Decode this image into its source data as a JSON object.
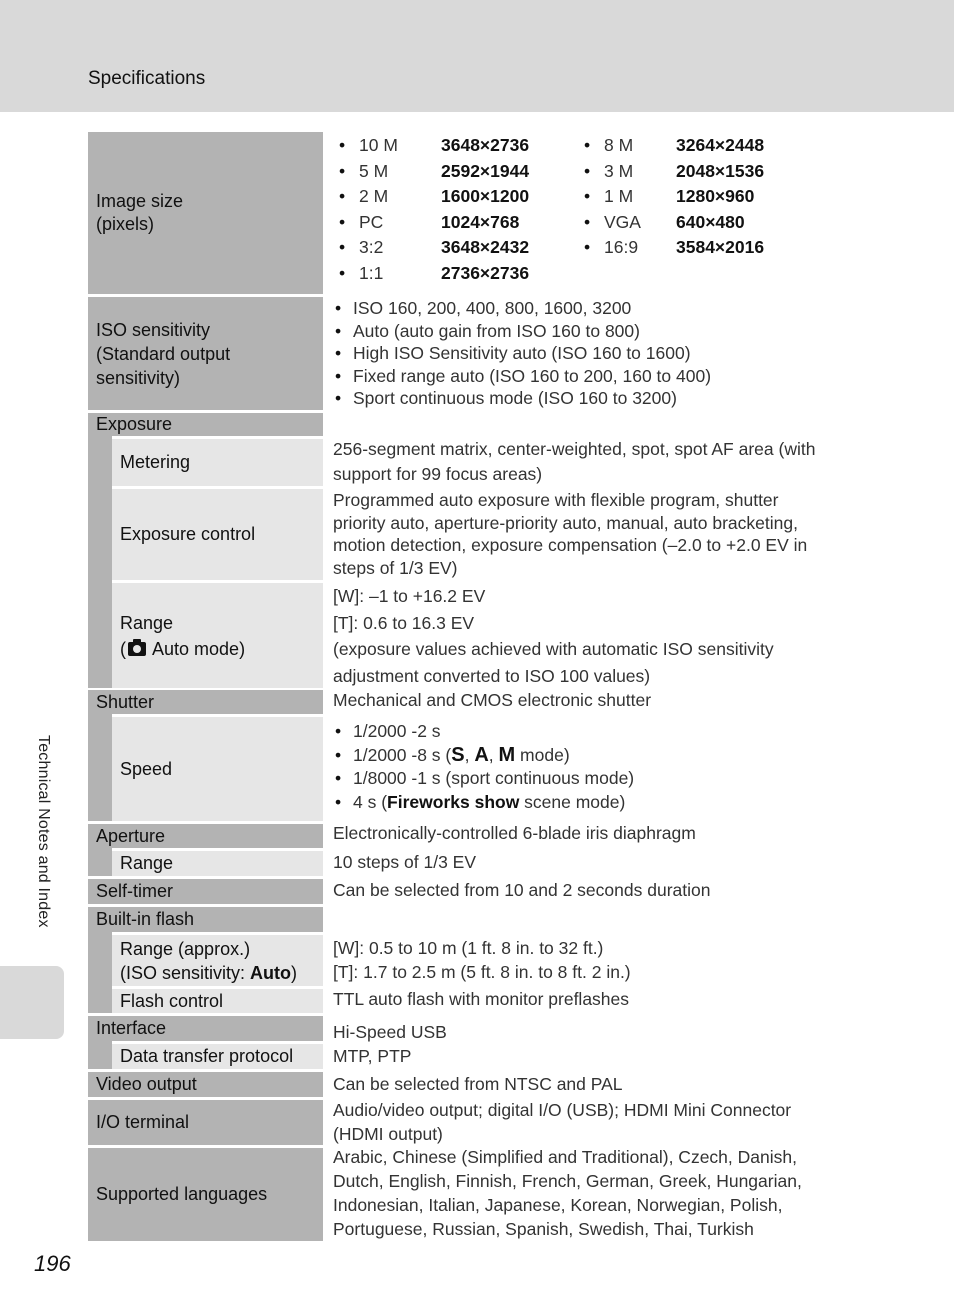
{
  "header": {
    "title": "Specifications"
  },
  "side_tab": {
    "label": "Technical Notes and Index"
  },
  "page_number": "196",
  "image_size": {
    "label_line1": "Image size",
    "label_line2": "(pixels)",
    "left": [
      {
        "name": "10 M",
        "res": "3648×2736"
      },
      {
        "name": "5 M",
        "res": "2592×1944"
      },
      {
        "name": "2 M",
        "res": "1600×1200"
      },
      {
        "name": "PC",
        "res": "1024×768"
      },
      {
        "name": "3:2",
        "res": "3648×2432"
      },
      {
        "name": "1:1",
        "res": "2736×2736"
      }
    ],
    "right": [
      {
        "name": "8 M",
        "res": "3264×2448"
      },
      {
        "name": "3 M",
        "res": "2048×1536"
      },
      {
        "name": "1 M",
        "res": "1280×960"
      },
      {
        "name": "VGA",
        "res": "640×480"
      },
      {
        "name": "16:9",
        "res": "3584×2016"
      }
    ]
  },
  "iso": {
    "label_lines": [
      "ISO sensitivity",
      "(Standard output",
      "sensitivity)"
    ],
    "items": [
      "ISO 160, 200, 400, 800, 1600, 3200",
      "Auto (auto gain from ISO 160 to 800)",
      "High ISO Sensitivity auto (ISO 160 to 1600)",
      "Fixed range auto (ISO 160 to 200, 160 to 400)",
      "Sport continuous mode (ISO 160 to 3200)"
    ]
  },
  "exposure": {
    "label": "Exposure",
    "metering": {
      "label": "Metering",
      "lines": [
        "256-segment matrix, center-weighted, spot, spot AF area (with",
        "support for 99 focus areas)"
      ]
    },
    "control": {
      "label": "Exposure control",
      "lines": [
        "Programmed auto exposure with flexible program, shutter",
        "priority auto, aperture-priority auto, manual, auto bracketing,",
        "motion detection, exposure compensation (–2.0 to +2.0 EV in",
        "steps of 1/3 EV)"
      ]
    },
    "range": {
      "label_line1": "Range",
      "label_open": "(",
      "label_icon": "camera-auto-icon",
      "label_rest": " Auto mode)",
      "lines": [
        "[W]: –1 to +16.2 EV",
        "[T]: 0.6 to 16.3 EV",
        "(exposure values achieved with automatic ISO sensitivity",
        "adjustment converted to ISO 100 values)"
      ]
    }
  },
  "shutter": {
    "label": "Shutter",
    "value": "Mechanical and CMOS electronic shutter",
    "speed": {
      "label": "Speed",
      "item1": "1/2000 -2 s",
      "item2_pre": "1/2000 -8 s (",
      "item2_modes": [
        "S",
        "A",
        "M"
      ],
      "item2_sep": ", ",
      "item2_post": " mode)",
      "item3": "1/8000 -1 s (sport continuous mode)",
      "item4_pre": "4 s (",
      "item4_bold": "Fireworks show",
      "item4_post": " scene mode)"
    }
  },
  "aperture": {
    "label": "Aperture",
    "value": "Electronically-controlled 6-blade iris diaphragm",
    "range": {
      "label": "Range",
      "value": "10 steps of 1/3 EV"
    }
  },
  "self_timer": {
    "label": "Self-timer",
    "value": "Can be selected from 10 and 2 seconds duration"
  },
  "flash": {
    "label": "Built-in flash",
    "range": {
      "label_line1": "Range (approx.)",
      "label_line2_pre": "(ISO sensitivity: ",
      "label_line2_bold": "Auto",
      "label_line2_post": ")",
      "lines": [
        "[W]: 0.5 to 10 m (1 ft. 8 in. to 32 ft.)",
        "[T]: 1.7 to 2.5 m (5 ft. 8 in. to 8 ft. 2 in.)"
      ]
    },
    "control": {
      "label": "Flash control",
      "value": "TTL auto flash with monitor preflashes"
    }
  },
  "interface": {
    "label": "Interface",
    "value": "Hi-Speed USB",
    "protocol": {
      "label": "Data transfer protocol",
      "value": "MTP, PTP"
    }
  },
  "video_output": {
    "label": "Video output",
    "value": "Can be selected from NTSC and PAL"
  },
  "io_terminal": {
    "label": "I/O terminal",
    "lines": [
      "Audio/video output; digital I/O (USB); HDMI Mini Connector",
      "(HDMI output)"
    ]
  },
  "languages": {
    "label": "Supported languages",
    "lines": [
      "Arabic, Chinese (Simplified and Traditional), Czech, Danish,",
      "Dutch, English, Finnish, French, German, Greek, Hungarian,",
      "Indonesian, Italian, Japanese, Korean, Norwegian, Polish,",
      "Portuguese, Russian, Spanish, Swedish, Thai, Turkish"
    ]
  }
}
